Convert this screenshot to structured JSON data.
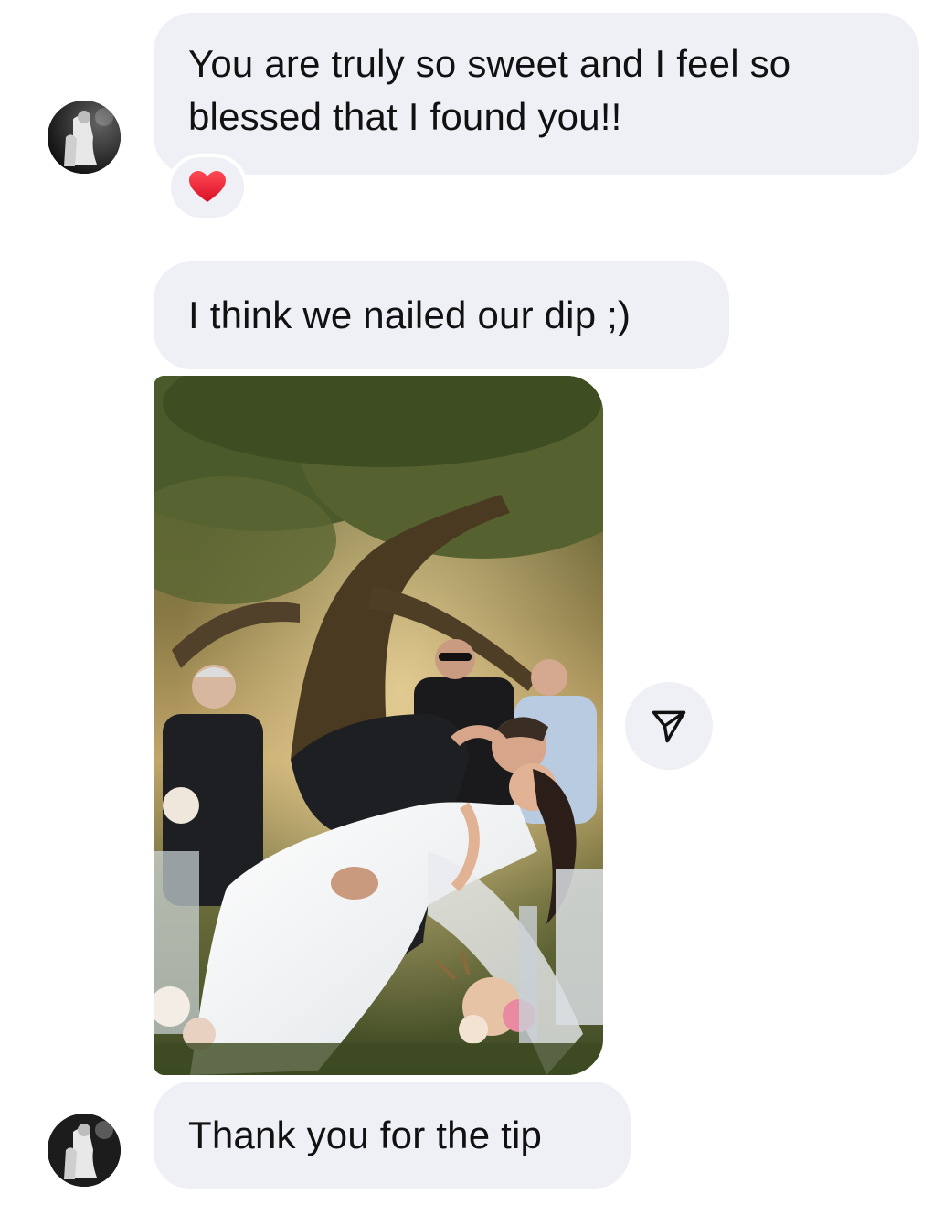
{
  "messages": [
    {
      "text_line1": "You are truly so sweet and I feel so",
      "text_line2": "blessed that I found you!!",
      "reaction": "❤️"
    },
    {
      "text": "I think we nailed our dip ;)"
    },
    {
      "text": "Thank you for the tip"
    }
  ],
  "icons": {
    "avatar": "contact-avatar-icon",
    "reaction": "red-heart-reaction-icon",
    "share": "share-paper-plane-icon"
  },
  "colors": {
    "bubble": "#eef0f5",
    "heart": "#e0142b"
  }
}
